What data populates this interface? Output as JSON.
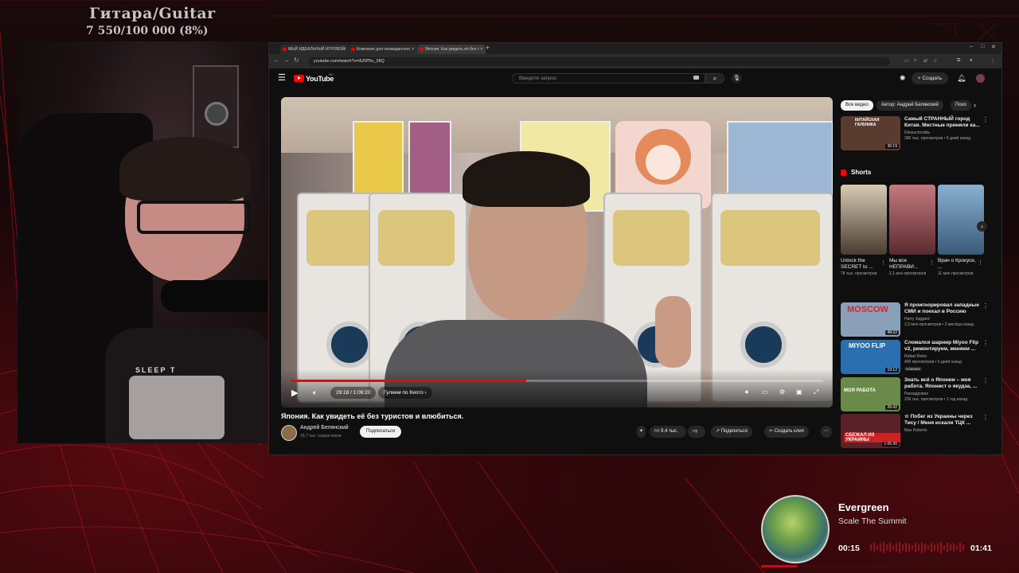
{
  "overlay": {
    "title": "Гитара/Guitar",
    "progress": "7 550/100 000 (8%)"
  },
  "webcam": {
    "shirt_text": "SLEEP T"
  },
  "browser": {
    "tabs": [
      {
        "label": "МЫЙ ИДЕАЛЬНЫЙ ИГРОВОЙ"
      },
      {
        "label": "Компания для неожиданного"
      },
      {
        "label": "Япония. Как увидеть её без т"
      }
    ],
    "url": "youtube.com/watch?v=i5ZtP5o_28Q"
  },
  "youtube": {
    "logo_text": "YouTube",
    "region": "RU",
    "search_placeholder": "Введите запрос",
    "create_label": "Создать",
    "player": {
      "time": "29:18 / 1:06:20",
      "chapter": "Гуляем по Киото",
      "progress": 0.442
    },
    "video": {
      "title": "Япония. Как увидеть её без туристов и влюбиться.",
      "channel": "Андрей Белянский",
      "subscribers": "33,7 тыс. подписчиков",
      "subscribe_label": "Подписаться",
      "likes": "9,4 тыс.",
      "share_label": "Поделиться",
      "clip_label": "Создать клип"
    },
    "sidebar": {
      "chips": [
        "Все видео",
        "Автор: Андрей Белянский",
        "Похо"
      ],
      "recommendations": [
        {
          "title": "Самый СТРАННЫЙ город Китая. Местные приняли ка...",
          "channel": "Dimaschmidta",
          "meta": "280 тыс. просмотров • 9 дней назад",
          "duration": "36:19",
          "thumb_text": "КИТАЙСКАЯ ГАУБНИКА",
          "thumb_color": "#5a3b30"
        },
        {
          "title": "Я проигнорировал западные СМИ и поехал в Россию",
          "channel": "Harry Jaggard",
          "meta": "2,3 млн просмотров • 2 месяца назад",
          "duration": "48:22",
          "thumb_text": "MOSCOW",
          "thumb_color": "#8aa0b8"
        },
        {
          "title": "Сломался шарнир Miyoo Flip v2, ремонтируем, меняем ...",
          "channel": "Rafael Retro",
          "meta": "400 просмотров • 5 дней назад",
          "duration": "19:12",
          "thumb_text": "MIYOO FLIP",
          "thumb_color": "#2a6fb0",
          "badge": "Новинка"
        },
        {
          "title": "Знать всё о Японии – моя работа. Японист о якудза, ...",
          "channel": "Раскадровка",
          "meta": "236 тыс. просмотров • 1 год назад",
          "duration": "26:42",
          "thumb_text": "МОЯ РАБОТА",
          "thumb_color": "#6a8a4a"
        },
        {
          "title": "☆ Побег из Украины через Тису / Меня искали ТЦК ...",
          "channel": "Max Roberts",
          "meta": "",
          "duration": "1:05:30",
          "thumb_text": "СБЕЖАЛ ИЗ УКРАИНЫ",
          "thumb_color": "#5a2226"
        }
      ],
      "shorts_label": "Shorts",
      "shorts": [
        {
          "title": "Unlock the SECRET to ...",
          "views": "78 тыс. просмотров",
          "color": "#4a3a30"
        },
        {
          "title": "Мы все НЕПРАВИ...",
          "views": "2,1 млн просмотров",
          "color": "#7a3a3e"
        },
        {
          "title": "Врач о Крокусе, ...",
          "views": "11 млн просмотров",
          "color": "#3a5a7a"
        }
      ]
    }
  },
  "music": {
    "track": "Evergreen",
    "artist": "Scale The Summit",
    "current": "00:15",
    "total": "01:41",
    "progress": 0.15
  }
}
